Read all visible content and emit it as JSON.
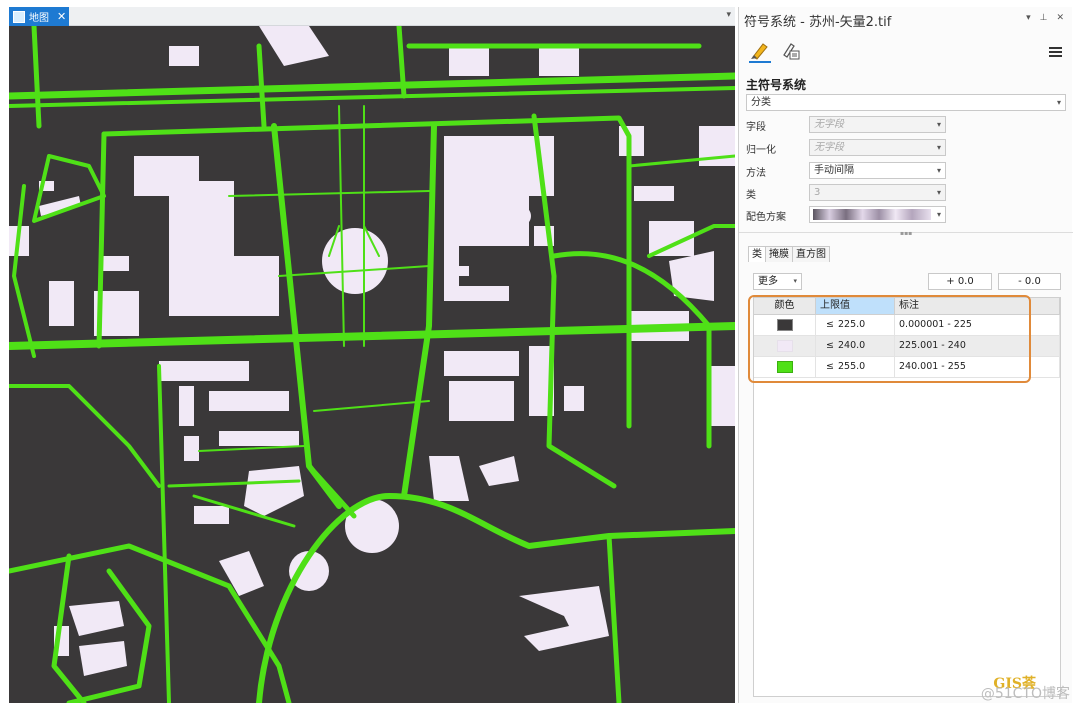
{
  "map": {
    "tab_label": "地图",
    "close_glyph": "✕",
    "dropdown_glyph": "▾",
    "colors": {
      "background": "#3a3839",
      "roads": "#4fe017",
      "buildings": "#f1e9f6"
    }
  },
  "panel": {
    "title": "符号系统 - 苏州-矢量2.tif",
    "controls": [
      "▾",
      "⊥",
      "✕"
    ],
    "tools": [
      "primary-symbology-icon",
      "secondary-symbology-icon"
    ],
    "section_title": "主符号系统",
    "renderer": {
      "value": "分类"
    },
    "props": {
      "field": {
        "label": "字段",
        "value": "无字段"
      },
      "normalize": {
        "label": "归一化",
        "value": "无字段"
      },
      "method": {
        "label": "方法",
        "value": "手动间隔"
      },
      "classes": {
        "label": "类",
        "value": "3"
      },
      "color_scheme": {
        "label": "配色方案"
      }
    },
    "tabs": [
      "类",
      "掩膜",
      "直方图"
    ],
    "more_label": "更多",
    "plus_label": "+ 0.0",
    "minus_label": "- 0.0",
    "grid": {
      "headers": {
        "color": "颜色",
        "upper": "上限值",
        "label": "标注"
      },
      "lte": "≤",
      "rows": [
        {
          "color": "#3a3839",
          "upper": "225.0",
          "label": "0.000001 - 225"
        },
        {
          "color": "#f1e9f6",
          "upper": "240.0",
          "label": "225.001 - 240"
        },
        {
          "color": "#4fe017",
          "upper": "255.0",
          "label": "240.001 - 255"
        }
      ]
    }
  },
  "watermark": {
    "brand": "GIS荟",
    "text": "@51CTO博客"
  }
}
